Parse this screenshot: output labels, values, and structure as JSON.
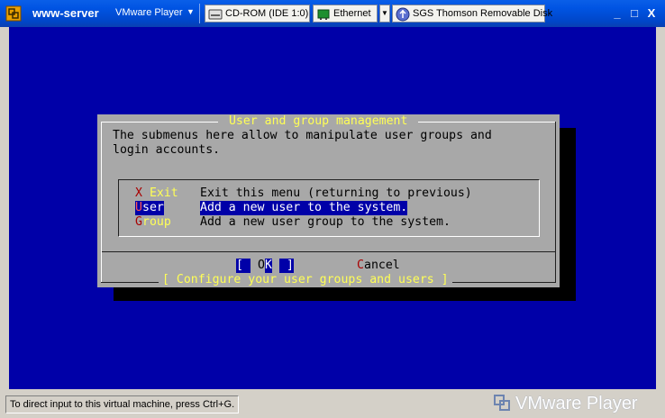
{
  "window": {
    "vm_name": "www-server",
    "player_menu": "VMware Player",
    "devices": [
      {
        "label": "CD-ROM (IDE 1:0)",
        "icon": "cdrom-icon"
      },
      {
        "label": "Ethernet",
        "icon": "network-icon"
      },
      {
        "label": "SGS Thomson Removable Disk",
        "icon": "usb-icon"
      }
    ],
    "controls": {
      "minimize": "_",
      "maximize": "□",
      "close": "X"
    }
  },
  "dialog": {
    "title": " User and group management ",
    "intro_line1": "The submenus here allow to manipulate user groups and",
    "intro_line2": "login accounts.",
    "menu": [
      {
        "key": "X",
        "rest": " Exit",
        "description": "Exit this menu (returning to previous)"
      },
      {
        "key": "U",
        "rest": "ser",
        "description": "Add a new user to the system."
      },
      {
        "key": "G",
        "rest": "roup",
        "description": "Add a new user group to the system."
      }
    ],
    "ok_button": {
      "open": "[ ",
      "key": "O",
      "rest": "K",
      "close": " ]"
    },
    "cancel_button": {
      "key": "C",
      "rest": "ancel"
    },
    "footer": "[ Configure your user groups and users ]"
  },
  "status": {
    "hint": "To direct input to this virtual machine, press Ctrl+G.",
    "brand": "VMware Player"
  },
  "colors": {
    "console_bg": "#0000a8",
    "dialog_bg": "#a8a8a8",
    "accent_yellow": "#ffff55",
    "hotkey_red": "#a80000"
  }
}
